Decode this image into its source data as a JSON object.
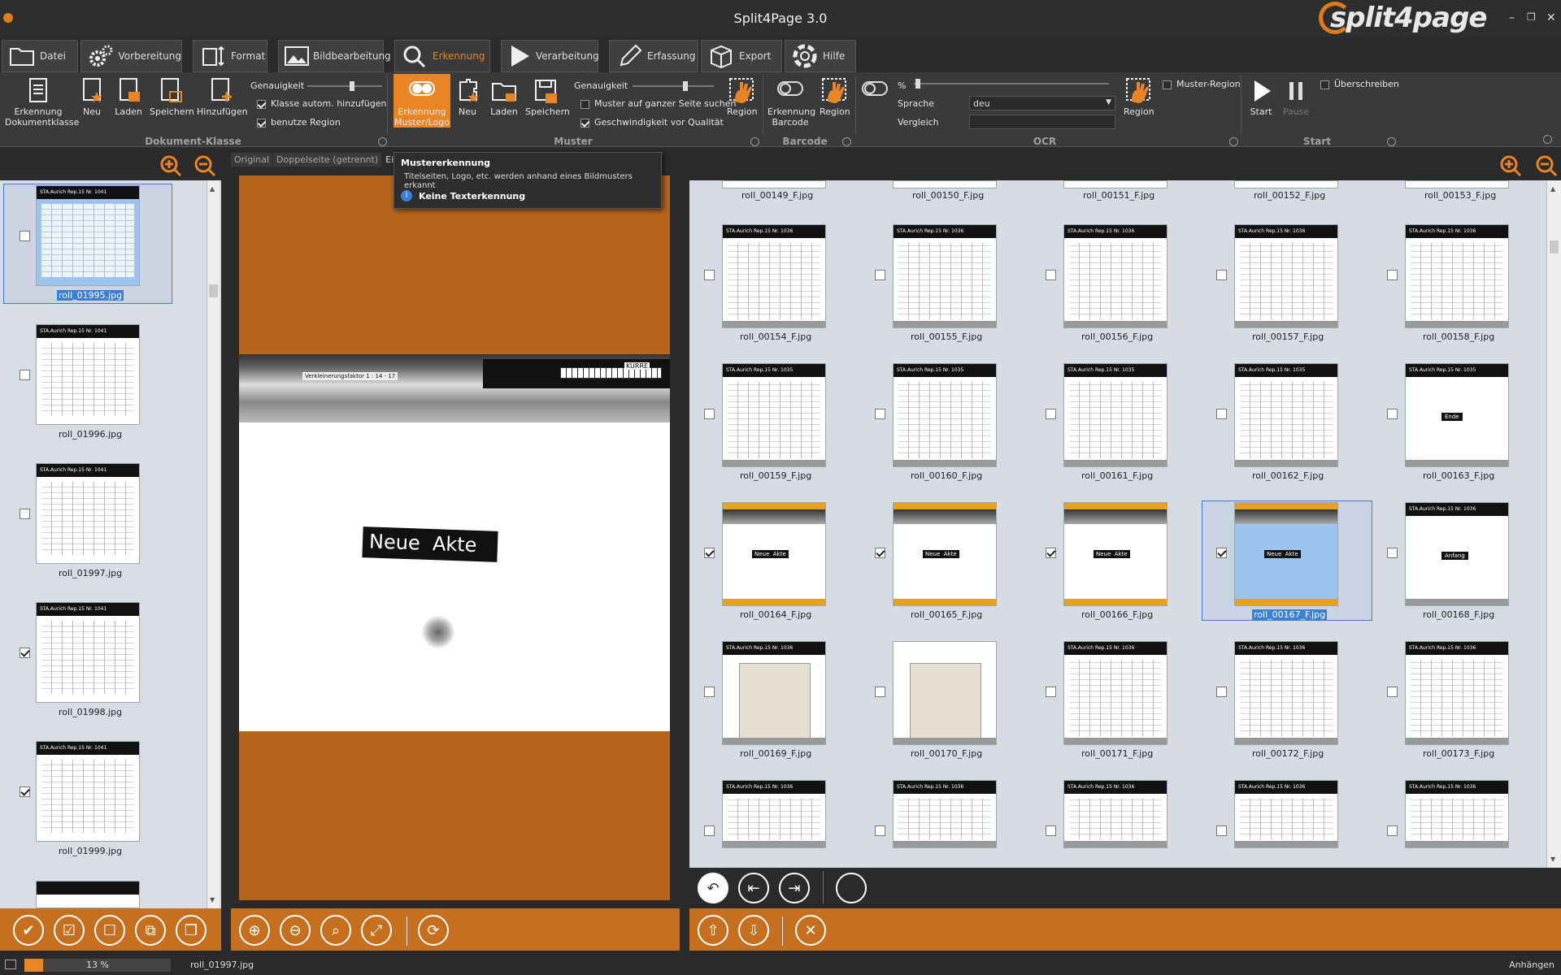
{
  "app": {
    "title": "Split4Page 3.0",
    "logo": "split4page"
  },
  "window_controls": [
    "–",
    "❐",
    "✕"
  ],
  "tabs": [
    {
      "label": "Datei",
      "icon": "folder-icon"
    },
    {
      "label": "Vorbereitung",
      "icon": "gears-icon"
    },
    {
      "label": "Format",
      "icon": "format-icon"
    },
    {
      "label": "Bildbearbeitung",
      "icon": "image-icon"
    },
    {
      "label": "Erkennung",
      "icon": "search-icon",
      "active": true
    },
    {
      "label": "Verarbeitung",
      "icon": "play-icon"
    },
    {
      "label": "Erfassung",
      "icon": "pencil-icon"
    },
    {
      "label": "Export",
      "icon": "box-icon"
    },
    {
      "label": "Hilfe",
      "icon": "lifebuoy-icon"
    }
  ],
  "ribbon": {
    "doc_class": {
      "erkennung": "Erkennung Dokumentklasse",
      "neu": "Neu",
      "laden": "Laden",
      "speichern": "Speichern",
      "hinzufuegen": "Hinzufügen",
      "genauigkeit": "Genauigkeit",
      "klasse_autom": "Klasse autom. hinzufügen",
      "benutze_region": "benutze Region"
    },
    "muster": {
      "erkennung": "Erkennung Muster/Logo",
      "neu": "Neu",
      "laden": "Laden",
      "speichern": "Speichern",
      "genauigkeit": "Genauigkeit",
      "ganzer_seite": "Muster auf ganzer Seite suchen",
      "geschwindigkeit": "Geschwindigkeit vor Qualität",
      "region": "Region"
    },
    "barcode": {
      "erkennung": "Erkennung Barcode",
      "region": "Region"
    },
    "ocr": {
      "percent": "%",
      "sprache_label": "Sprache",
      "sprache_value": "deu",
      "vergleich_label": "Vergleich",
      "vergleich_value": "",
      "region": "Region",
      "muster_region": "Muster-Region"
    },
    "start": {
      "start": "Start",
      "pause": "Pause",
      "ueberschreiben": "Überschreiben"
    },
    "groups": [
      "Dokument-Klasse",
      "Muster",
      "Barcode",
      "OCR",
      "Start"
    ]
  },
  "tooltip": {
    "title": "Mustererkennung",
    "body": "Titelseiten, Logo, etc. werden anhand eines Bildmusters erkannt",
    "info": "Keine Texterkennung"
  },
  "view_tabs": [
    "Original",
    "Doppelseite (getrennt)",
    "Einzels"
  ],
  "preview": {
    "scale_text": "Verkleinerungsfaktor 1 : 14 - 17",
    "kurre": "KURRE",
    "label": "Neue  Akte"
  },
  "left_thumbs": [
    {
      "name": "roll_01995.jpg",
      "checked": false,
      "selected": true,
      "header": "STA.Aurich Rep.15  Nr. 1041"
    },
    {
      "name": "roll_01996.jpg",
      "checked": false,
      "selected": false,
      "header": "STA.Aurich Rep.15  Nr. 1041"
    },
    {
      "name": "roll_01997.jpg",
      "checked": false,
      "selected": false,
      "header": "STA.Aurich Rep.15  Nr. 1041"
    },
    {
      "name": "roll_01998.jpg",
      "checked": true,
      "selected": false,
      "header": "STA.Aurich Rep.15  Nr. 1041"
    },
    {
      "name": "roll_01999.jpg",
      "checked": true,
      "selected": false,
      "header": "STA.Aurich Rep.15  Nr. 1041"
    }
  ],
  "grid_top_row": [
    "roll_00149_F.jpg",
    "roll_00150_F.jpg",
    "roll_00151_F.jpg",
    "roll_00152_F.jpg",
    "roll_00153_F.jpg"
  ],
  "grid_rows": [
    [
      {
        "name": "roll_00154_F.jpg",
        "checked": false,
        "kind": "table",
        "header": "STA.Aurich Rep.15  Nr. 1036"
      },
      {
        "name": "roll_00155_F.jpg",
        "checked": false,
        "kind": "table",
        "header": "STA.Aurich Rep.15  Nr. 1036"
      },
      {
        "name": "roll_00156_F.jpg",
        "checked": false,
        "kind": "table",
        "header": "STA.Aurich Rep.15  Nr. 1036"
      },
      {
        "name": "roll_00157_F.jpg",
        "checked": false,
        "kind": "table",
        "header": "STA.Aurich Rep.15  Nr. 1036"
      },
      {
        "name": "roll_00158_F.jpg",
        "checked": false,
        "kind": "table",
        "header": "STA.Aurich Rep.15  Nr. 1036"
      }
    ],
    [
      {
        "name": "roll_00159_F.jpg",
        "checked": false,
        "kind": "table",
        "header": "STA.Aurich Rep.15  Nr. 1035"
      },
      {
        "name": "roll_00160_F.jpg",
        "checked": false,
        "kind": "table",
        "header": "STA.Aurich Rep.15  Nr. 1035"
      },
      {
        "name": "roll_00161_F.jpg",
        "checked": false,
        "kind": "table",
        "header": "STA.Aurich Rep.15  Nr. 1035"
      },
      {
        "name": "roll_00162_F.jpg",
        "checked": false,
        "kind": "table",
        "header": "STA.Aurich Rep.15  Nr. 1035"
      },
      {
        "name": "roll_00163_F.jpg",
        "checked": false,
        "kind": "label",
        "header": "STA.Aurich Rep.15  Nr. 1035",
        "label": "Ende"
      }
    ],
    [
      {
        "name": "roll_00164_F.jpg",
        "checked": true,
        "kind": "akte",
        "header": "",
        "label": "Neue  Akte"
      },
      {
        "name": "roll_00165_F.jpg",
        "checked": true,
        "kind": "akte",
        "header": "",
        "label": "Neue  Akte"
      },
      {
        "name": "roll_00166_F.jpg",
        "checked": true,
        "kind": "akte",
        "header": "",
        "label": "Neue  Akte"
      },
      {
        "name": "roll_00167_F.jpg",
        "checked": true,
        "kind": "akte-sel",
        "header": "",
        "label": "Neue  Akte",
        "selected": true
      },
      {
        "name": "roll_00168_F.jpg",
        "checked": false,
        "kind": "label",
        "header": "STA.Aurich Rep.15  Nr. 1036",
        "label": "Anfang"
      }
    ],
    [
      {
        "name": "roll_00169_F.jpg",
        "checked": false,
        "kind": "cover",
        "header": "STA.Aurich Rep.15  Nr. 1036"
      },
      {
        "name": "roll_00170_F.jpg",
        "checked": false,
        "kind": "cover",
        "header": ""
      },
      {
        "name": "roll_00171_F.jpg",
        "checked": false,
        "kind": "table",
        "header": "STA.Aurich Rep.15  Nr. 1036"
      },
      {
        "name": "roll_00172_F.jpg",
        "checked": false,
        "kind": "table",
        "header": "STA.Aurich Rep.15  Nr. 1036"
      },
      {
        "name": "roll_00173_F.jpg",
        "checked": false,
        "kind": "table",
        "header": "STA.Aurich Rep.15  Nr. 1036"
      }
    ],
    [
      {
        "name": "",
        "checked": false,
        "kind": "table",
        "header": "STA.Aurich Rep.15  Nr. 1036"
      },
      {
        "name": "",
        "checked": false,
        "kind": "table",
        "header": "STA.Aurich Rep.15  Nr. 1036"
      },
      {
        "name": "",
        "checked": false,
        "kind": "table",
        "header": "STA.Aurich Rep.15  Nr. 1036"
      },
      {
        "name": "",
        "checked": false,
        "kind": "table",
        "header": "STA.Aurich Rep.15  Nr. 1036"
      },
      {
        "name": "",
        "checked": false,
        "kind": "table",
        "header": "STA.Aurich Rep.15  Nr. 1036"
      }
    ]
  ],
  "status": {
    "progress_text": "13 %",
    "progress": 0.13,
    "filename": "roll_01997.jpg",
    "right": "Anhängen"
  },
  "colors": {
    "accent": "#e98525",
    "orange_bar": "#c66f1f",
    "selection": "#3b7fd6"
  }
}
